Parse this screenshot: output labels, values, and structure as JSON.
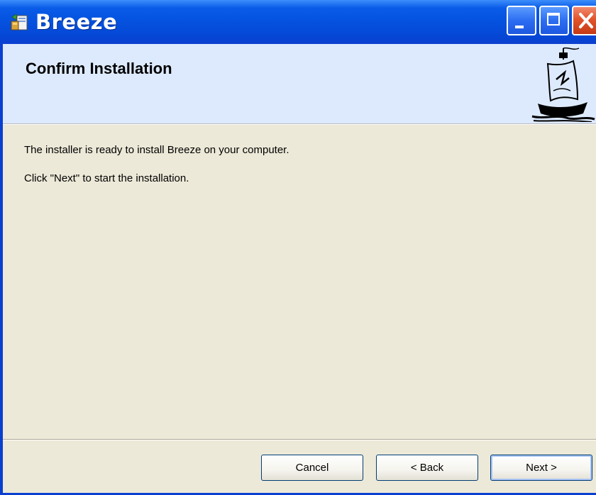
{
  "window": {
    "title": "Breeze",
    "icon": "installer-icon"
  },
  "titlebar_buttons": {
    "minimize": "minimize-icon",
    "maximize": "maximize-icon",
    "close": "close-icon"
  },
  "banner": {
    "heading": "Confirm Installation",
    "logo": "ship-logo"
  },
  "body": {
    "line1": "The installer is ready to install Breeze on your computer.",
    "line2": "Click \"Next\" to start the installation."
  },
  "buttons": {
    "cancel": "Cancel",
    "back": "< Back",
    "next": "Next >"
  },
  "colors": {
    "titlebar": "#0553e0",
    "banner": "#ddeafe",
    "dialog": "#ece9d8",
    "close": "#e2542b"
  }
}
